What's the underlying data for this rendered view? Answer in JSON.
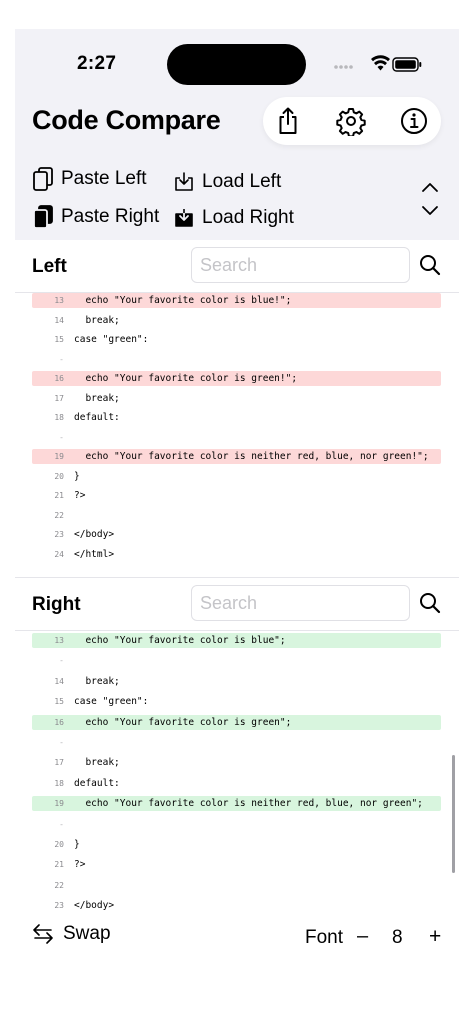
{
  "status_bar": {
    "time": "2:27"
  },
  "app": {
    "title": "Code Compare"
  },
  "actions": {
    "paste_left": "Paste Left",
    "load_left": "Load Left",
    "paste_right": "Paste Right",
    "load_right": "Load Right"
  },
  "icons": {
    "share": "share-icon",
    "settings": "gear-icon",
    "info": "info-icon",
    "search": "search-icon",
    "swap": "swap-arrows-icon",
    "chevron_up": "chevron-up-icon",
    "chevron_down": "chevron-down-icon"
  },
  "left_pane": {
    "title": "Left",
    "search_placeholder": "Search",
    "lines": [
      {
        "num": "13",
        "text": "  echo \"Your favorite color is blue!\";",
        "type": "removed"
      },
      {
        "num": "14",
        "text": "  break;",
        "type": "normal"
      },
      {
        "num": "15",
        "text": "case \"green\":",
        "type": "normal"
      },
      {
        "num": "-",
        "text": "",
        "type": "gap"
      },
      {
        "num": "16",
        "text": "  echo \"Your favorite color is green!\";",
        "type": "removed"
      },
      {
        "num": "17",
        "text": "  break;",
        "type": "normal"
      },
      {
        "num": "18",
        "text": "default:",
        "type": "normal"
      },
      {
        "num": "-",
        "text": "",
        "type": "gap"
      },
      {
        "num": "19",
        "text": "  echo \"Your favorite color is neither red, blue, nor green!\";",
        "type": "removed"
      },
      {
        "num": "20",
        "text": "}",
        "type": "normal"
      },
      {
        "num": "21",
        "text": "?>",
        "type": "normal"
      },
      {
        "num": "22",
        "text": "",
        "type": "normal"
      },
      {
        "num": "23",
        "text": "</body>",
        "type": "normal"
      },
      {
        "num": "24",
        "text": "</html>",
        "type": "normal"
      }
    ]
  },
  "right_pane": {
    "title": "Right",
    "search_placeholder": "Search",
    "lines": [
      {
        "num": "13",
        "text": "  echo \"Your favorite color is blue\";",
        "type": "added"
      },
      {
        "num": "-",
        "text": "",
        "type": "gap"
      },
      {
        "num": "14",
        "text": "  break;",
        "type": "normal"
      },
      {
        "num": "15",
        "text": "case \"green\":",
        "type": "normal"
      },
      {
        "num": "16",
        "text": "  echo \"Your favorite color is green\";",
        "type": "added"
      },
      {
        "num": "-",
        "text": "",
        "type": "gap"
      },
      {
        "num": "17",
        "text": "  break;",
        "type": "normal"
      },
      {
        "num": "18",
        "text": "default:",
        "type": "normal"
      },
      {
        "num": "19",
        "text": "  echo \"Your favorite color is neither red, blue, nor green\";",
        "type": "added"
      },
      {
        "num": "-",
        "text": "",
        "type": "gap"
      },
      {
        "num": "20",
        "text": "}",
        "type": "normal"
      },
      {
        "num": "21",
        "text": "?>",
        "type": "normal"
      },
      {
        "num": "22",
        "text": "",
        "type": "normal"
      },
      {
        "num": "23",
        "text": "</body>",
        "type": "normal"
      }
    ]
  },
  "bottom_bar": {
    "swap_label": "Swap",
    "font_label": "Font",
    "font_minus": "–",
    "font_size": "8",
    "font_plus": "+"
  },
  "colors": {
    "removed_bg": "#fdd8d8",
    "added_bg": "#d8f5de",
    "top_bg": "#f2f2f7"
  }
}
